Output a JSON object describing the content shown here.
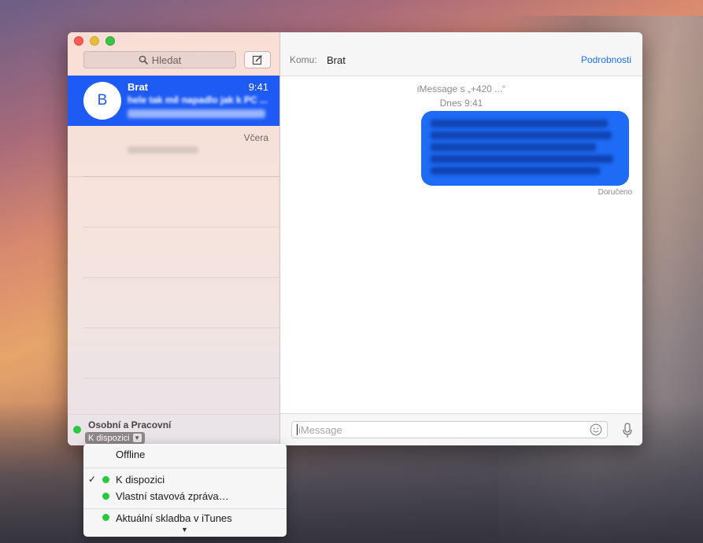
{
  "colors": {
    "selected_accent": "#1e5bf5",
    "bubble": "#1e6bf5",
    "link": "#1a73e8",
    "status_green": "#27c93f"
  },
  "sidebar": {
    "search_placeholder": "Hledat",
    "search_icon": "magnifier-icon",
    "compose_icon": "compose-pencil-icon",
    "conversations": [
      {
        "avatar_letter": "B",
        "name": "Brat",
        "time": "9:41",
        "preview": "hele tak mě napadlo jak k PC ...",
        "selected": true
      },
      {
        "avatar_letter": "",
        "name": "",
        "time": "Včera",
        "preview": "",
        "selected": false
      }
    ],
    "status": {
      "account": "Osobní a Pracovní",
      "value": "K dispozici"
    }
  },
  "chat": {
    "to_label": "Komu:",
    "to_name": "Brat",
    "details_link": "Podrobnosti",
    "service_line": "iMessage s „+420 ...“",
    "date_line": "Dnes 9:41",
    "delivered": "Doručeno",
    "input_placeholder": "iMessage",
    "emoji_icon": "emoji-smiley-icon",
    "mic_icon": "microphone-icon"
  },
  "status_menu": {
    "items": [
      {
        "label": "Offline",
        "checked": false,
        "dot": false
      },
      {
        "label": "K dispozici",
        "checked": true,
        "dot": true
      },
      {
        "label": "Vlastní stavová zpráva…",
        "checked": false,
        "dot": true
      },
      {
        "label": "Aktuální skladba v iTunes",
        "checked": false,
        "dot": true
      }
    ],
    "check_symbol": "✓",
    "more_arrow": "▼"
  }
}
